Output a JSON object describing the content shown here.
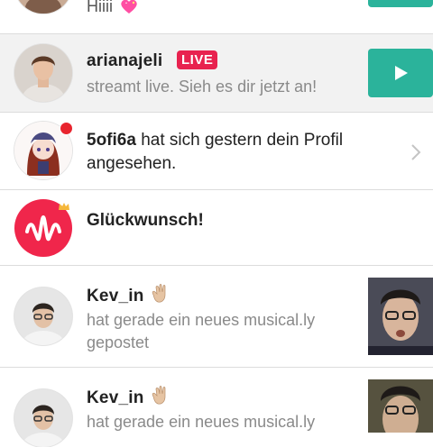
{
  "rows": [
    {
      "type": "message",
      "text": "Hiiii"
    },
    {
      "type": "live",
      "username": "arianajeli",
      "badge": "LIVE",
      "subtitle": "streamt live. Sieh es dir jetzt an!"
    },
    {
      "type": "profile_view",
      "username": "5ofi6a",
      "message": " hat sich gestern dein Profil angesehen."
    },
    {
      "type": "congrats",
      "message": "Glückwunsch!"
    },
    {
      "type": "post",
      "username": "Kev_in",
      "subtitle": "hat gerade ein neues musical.ly gepostet"
    },
    {
      "type": "post",
      "username": "Kev_in",
      "subtitle": "hat gerade ein neues musical.ly"
    }
  ],
  "icons": {
    "heart": "sparkling-heart-icon",
    "play": "play-icon",
    "chevron": "chevron-right-icon",
    "wave": "waving-hand-icon",
    "app_logo": "musically-logo-icon",
    "crown": "crown-icon"
  },
  "colors": {
    "live_badge": "#e8224f",
    "teal_button": "#2bb39b",
    "musically_brand": "#f0264b",
    "unread_dot": "#e8242e",
    "highlight_row": "#f2f2f2"
  }
}
